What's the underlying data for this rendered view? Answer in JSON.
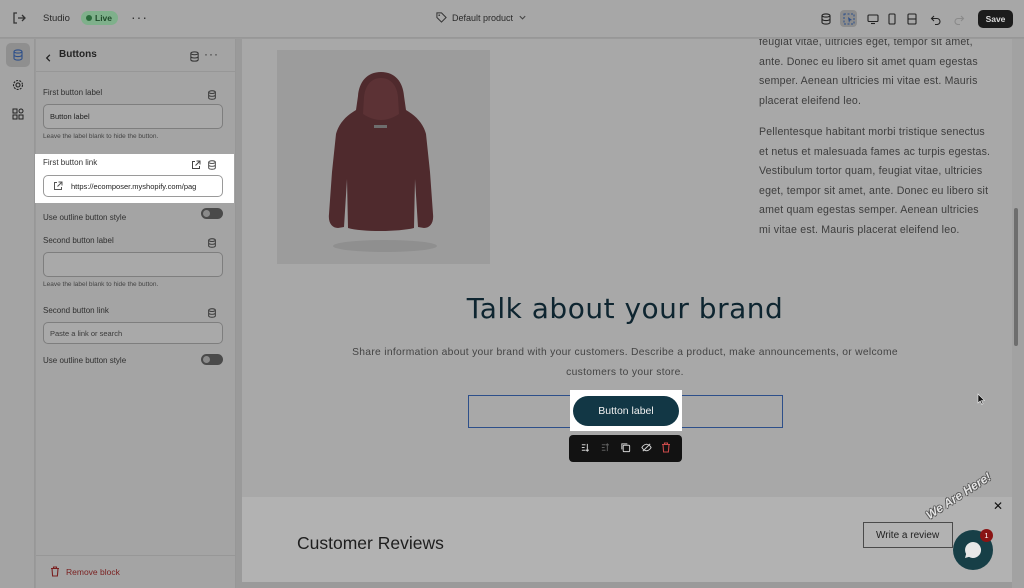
{
  "topbar": {
    "studio_label": "Studio",
    "live_badge": "Live",
    "product_selector": "Default product",
    "save_label": "Save"
  },
  "panel": {
    "title": "Buttons",
    "first_button_label": {
      "label": "First button label",
      "value": "Button label",
      "help": "Leave the label blank to hide the button."
    },
    "first_button_link": {
      "label": "First button link",
      "value": "https://ecomposer.myshopify.com/pag"
    },
    "outline_1": {
      "label": "Use outline button style"
    },
    "second_button_label": {
      "label": "Second button label",
      "value": "",
      "help": "Leave the label blank to hide the button."
    },
    "second_button_link": {
      "label": "Second button link",
      "placeholder": "Paste a link or search"
    },
    "outline_2": {
      "label": "Use outline button style"
    },
    "remove_block": "Remove block"
  },
  "preview": {
    "paragraph_1": "feugiat vitae, ultricies eget, tempor sit amet, ante. Donec eu libero sit amet quam egestas semper. Aenean ultricies mi vitae est. Mauris placerat eleifend leo.",
    "paragraph_2": "Pellentesque habitant morbi tristique senectus et netus et malesuada fames ac turpis egestas. Vestibulum tortor quam, feugiat vitae, ultricies eget, tempor sit amet, ante. Donec eu libero sit amet quam egestas semper. Aenean ultricies mi vitae est. Mauris placerat eleifend leo.",
    "brand_title": "Talk about your brand",
    "brand_description": "Share information about your brand with your customers. Describe a product, make announcements, or welcome customers to your store.",
    "button_label": "Button label",
    "reviews_title": "Customer Reviews",
    "write_review": "Write a review"
  },
  "chat": {
    "badge_count": "1",
    "tagline": "We Are Here!"
  },
  "colors": {
    "brand_button": "#123745",
    "live_badge": "#7fb08b",
    "danger": "#7a1f1f"
  }
}
